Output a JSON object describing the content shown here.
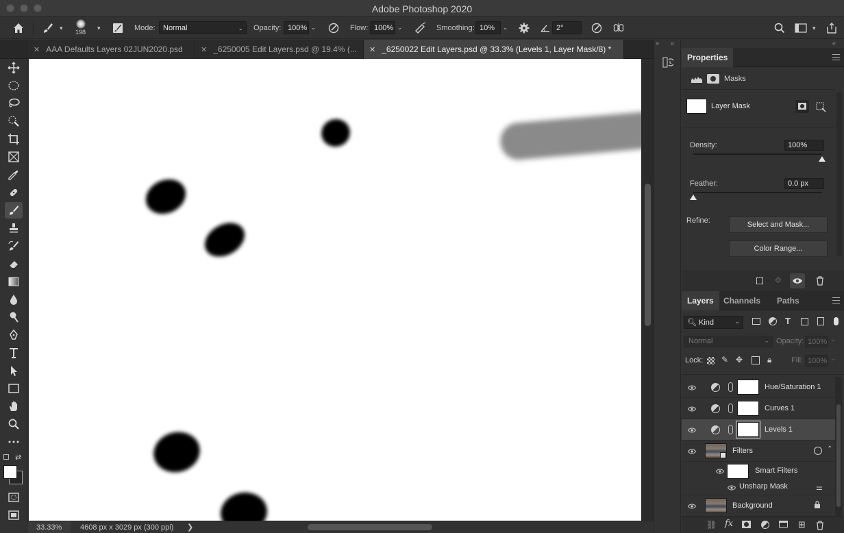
{
  "window": {
    "title": "Adobe Photoshop 2020"
  },
  "options_bar": {
    "brush_size": "198",
    "mode_label": "Mode:",
    "mode_value": "Normal",
    "opacity_label": "Opacity:",
    "opacity_value": "100%",
    "flow_label": "Flow:",
    "flow_value": "100%",
    "smoothing_label": "Smoothing:",
    "smoothing_value": "10%",
    "angle_value": "2°"
  },
  "tabs": [
    {
      "label": "AAA Defaults Layers 02JUN2020.psd",
      "active": false
    },
    {
      "label": "_6250005 Edit Layers.psd @ 19.4% (...",
      "active": false
    },
    {
      "label": "_6250022 Edit Layers.psd @ 33.3% (Levels 1, Layer Mask/8) *",
      "active": true
    }
  ],
  "status_bar": {
    "zoom": "33.33%",
    "dimensions": "4608 px x 3029 px (300 ppi)",
    "arrow": "❯"
  },
  "properties": {
    "tab_label": "Properties",
    "section_label": "Masks",
    "mask_label": "Layer Mask",
    "density_label": "Density:",
    "density_value": "100%",
    "density_fraction": 1.0,
    "feather_label": "Feather:",
    "feather_value": "0.0 px",
    "feather_fraction": 0.0,
    "refine_label": "Refine:",
    "select_mask_button": "Select and Mask...",
    "color_range_button": "Color Range..."
  },
  "layers_panel": {
    "tabs": [
      "Layers",
      "Channels",
      "Paths"
    ],
    "kind_label": "Kind",
    "blend_mode": "Normal",
    "opacity_label": "Opacity:",
    "opacity_value": "100%",
    "lock_label": "Lock:",
    "fill_label": "Fill:",
    "fill_value": "100%",
    "layers": [
      {
        "name": "Hue/Saturation 1"
      },
      {
        "name": "Curves 1"
      },
      {
        "name": "Levels 1"
      },
      {
        "name": "Filters"
      },
      {
        "name": "Smart Filters"
      },
      {
        "name": "Unsharp Mask"
      },
      {
        "name": "Background"
      }
    ]
  },
  "colors": {
    "panel_bg": "#323232",
    "canvas_bg": "#ffffff",
    "selected_layer": "#484848"
  }
}
